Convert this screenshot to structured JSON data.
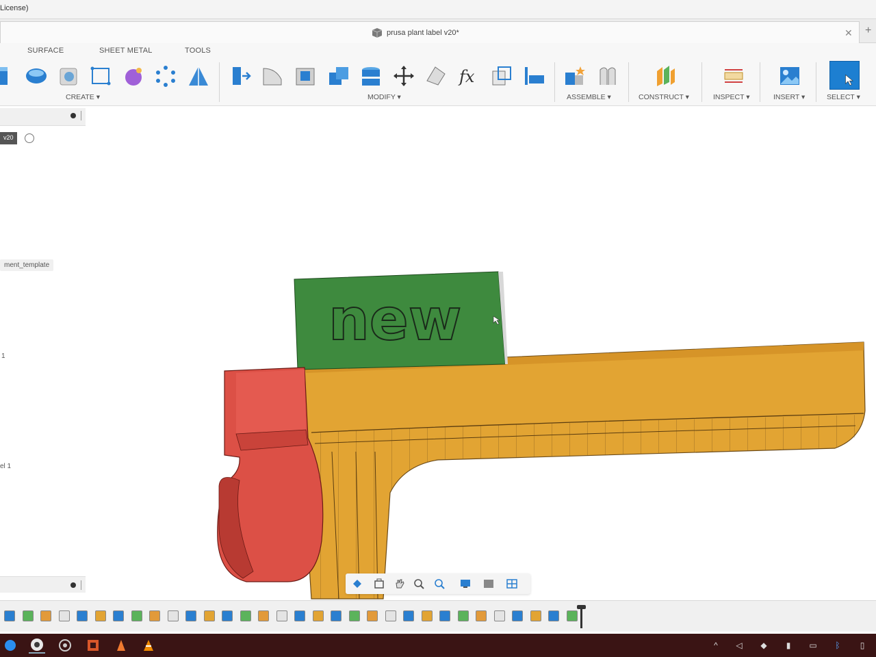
{
  "window": {
    "title_fragment": "License)",
    "document_name": "prusa plant label v20*"
  },
  "ribbon": {
    "tabs": [
      {
        "label": "SURFACE"
      },
      {
        "label": "SHEET METAL"
      },
      {
        "label": "TOOLS"
      }
    ],
    "groups": {
      "create": "CREATE ▾",
      "modify": "MODIFY ▾",
      "assemble": "ASSEMBLE ▾",
      "construct": "CONSTRUCT ▾",
      "inspect": "INSPECT ▾",
      "insert": "INSERT ▾",
      "select": "SELECT ▾"
    }
  },
  "browser": {
    "root_badge": "v20",
    "items": [
      {
        "label": "ment_template"
      },
      {
        "label": "1"
      },
      {
        "label": "el 1"
      }
    ]
  },
  "model": {
    "label_text": "new",
    "colors": {
      "label": "#3e8a3e",
      "stake": "#e2a433",
      "clip": "#dc5046"
    }
  },
  "colors": {
    "accent": "#1d7fd1",
    "taskbar": "#3a1414"
  }
}
